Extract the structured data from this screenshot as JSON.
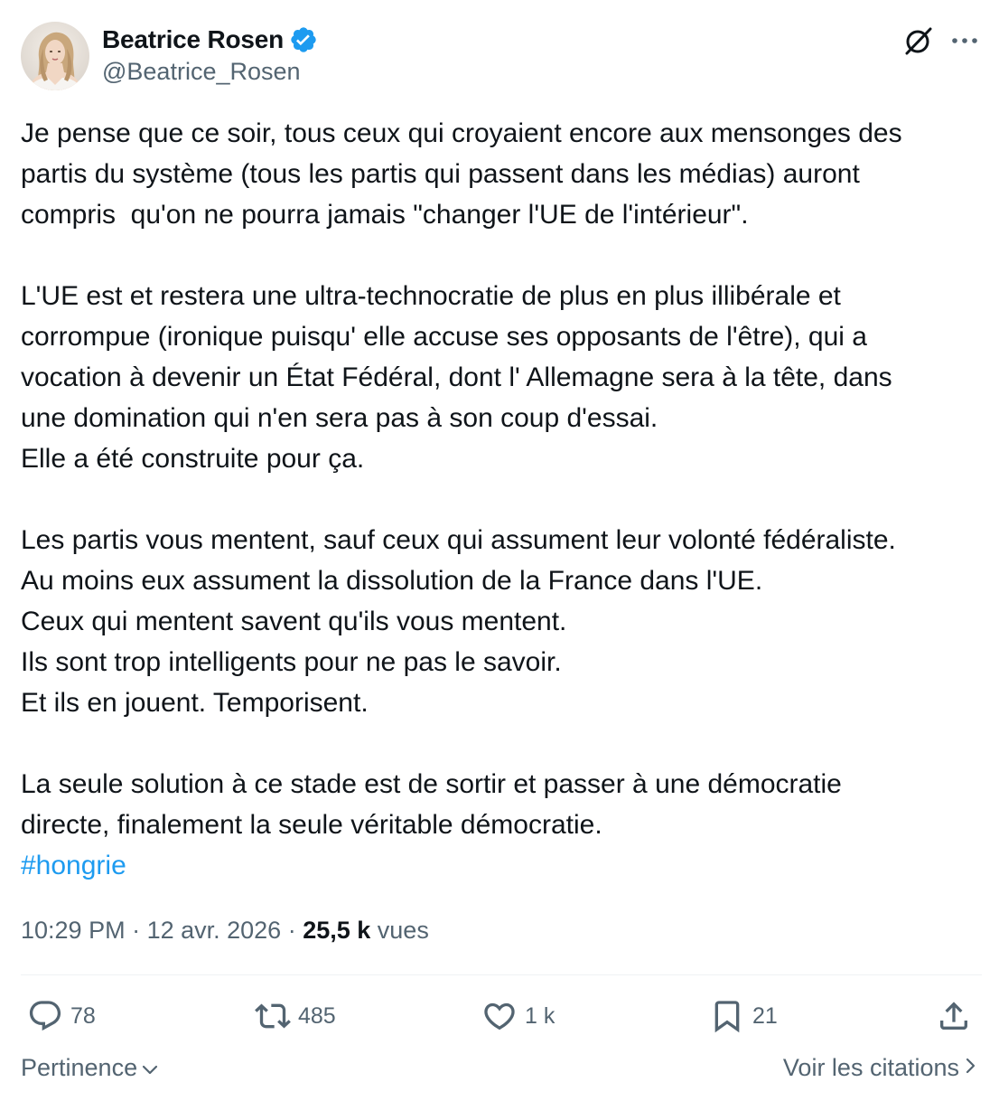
{
  "author": {
    "display_name": "Beatrice Rosen",
    "handle": "@Beatrice_Rosen",
    "verified": true,
    "verified_color": "#1d9bf0"
  },
  "tweet": {
    "paragraphs": [
      [
        "Je pense que ce soir, tous ceux qui croyaient encore aux mensonges des",
        "partis du système (tous les partis qui passent dans les médias) auront",
        "compris  qu'on ne pourra jamais \"changer l'UE de l'intérieur\"."
      ],
      [
        "L'UE est et restera une ultra-technocratie de plus en plus illibérale et",
        "corrompue (ironique puisqu' elle accuse ses opposants de l'être), qui a",
        "vocation à devenir un État Fédéral, dont l' Allemagne sera à la tête, dans",
        "une domination qui n'en sera pas à son coup d'essai.",
        "Elle a été construite pour ça."
      ],
      [
        "Les partis vous mentent, sauf ceux qui assument leur volonté fédéraliste.",
        "Au moins eux assument la dissolution de la France dans l'UE.",
        "Ceux qui mentent savent qu'ils vous mentent.",
        "Ils sont trop intelligents pour ne pas le savoir.",
        "Et ils en jouent. Temporisent."
      ],
      [
        "La seule solution à ce stade est de sortir et passer à une démocratie",
        "directe, finalement la seule véritable démocratie."
      ]
    ],
    "hashtag": "#hongrie",
    "hashtag_color": "#1d9bf0"
  },
  "meta": {
    "time": "10:29 PM",
    "separator": " · ",
    "date": "12 avr. 2026",
    "views_count": "25,5 k",
    "views_label": " vues"
  },
  "actions": {
    "replies": "78",
    "reposts": "485",
    "likes": "1 k",
    "bookmarks": "21",
    "icons": [
      "reply-icon",
      "repost-icon",
      "like-icon",
      "bookmark-icon",
      "share-icon"
    ]
  },
  "footer": {
    "sort_label": "Pertinence",
    "quotes_label": "Voir les citations"
  },
  "colors": {
    "text_primary": "#0f1419",
    "text_secondary": "#536471",
    "accent": "#1d9bf0",
    "divider": "#eff3f4"
  }
}
